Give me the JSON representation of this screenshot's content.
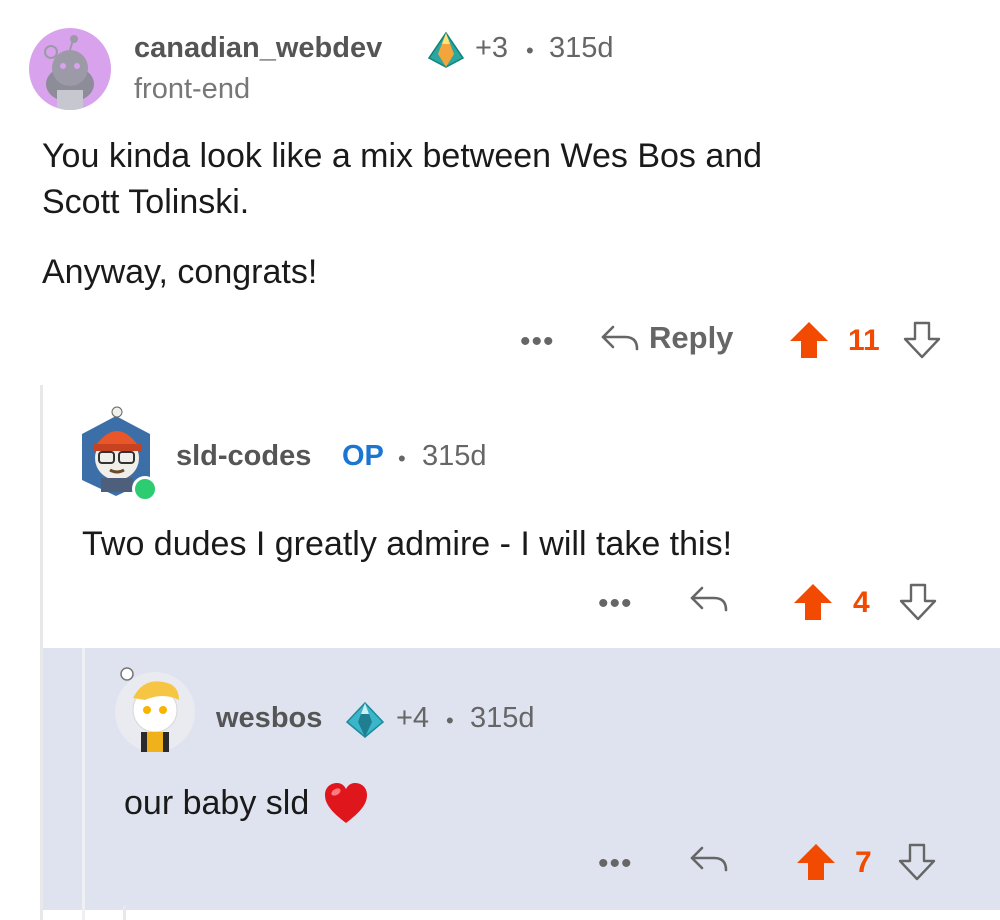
{
  "comments": [
    {
      "username": "canadian_webdev",
      "award_count": "+3",
      "separator": "•",
      "age": "315d",
      "flair": "front-end",
      "body": [
        "You kinda look like a mix between Wes Bos and",
        "Scott Tolinski.",
        "",
        "Anyway, congrats!"
      ],
      "reply_label": "Reply",
      "more_label": "•••",
      "votes": "11"
    },
    {
      "username": "sld-codes",
      "op_badge": "OP",
      "separator": "•",
      "age": "315d",
      "body": "Two dudes I greatly admire - I will take this!",
      "more_label": "•••",
      "votes": "4"
    },
    {
      "username": "wesbos",
      "award_count": "+4",
      "separator": "•",
      "age": "315d",
      "body": "our baby sld",
      "more_label": "•••",
      "votes": "7"
    }
  ],
  "colors": {
    "upvote": "#f24a00",
    "op": "#1b76d1",
    "highlight_bg": "#dfe3ef",
    "online": "#2ecc71"
  },
  "icons": [
    "award-pyramid-icon",
    "reply-arrow-icon",
    "upvote-arrow-icon",
    "downvote-arrow-icon",
    "heart-emoji-icon"
  ]
}
